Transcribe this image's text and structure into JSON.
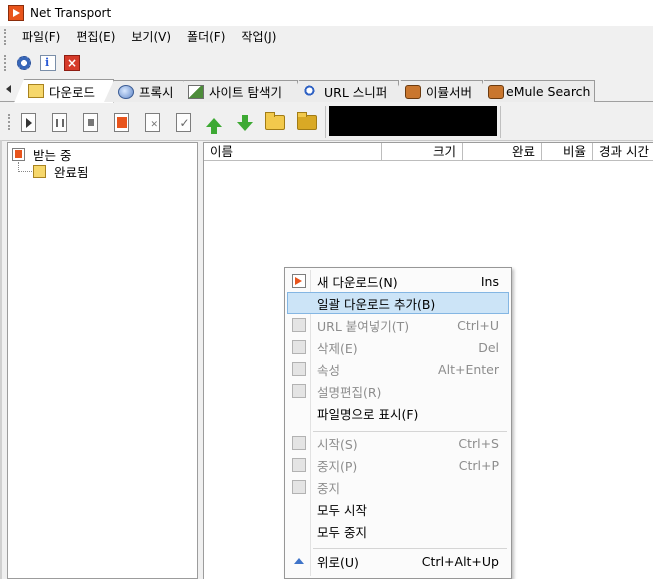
{
  "window": {
    "title": "Net Transport"
  },
  "menubar": [
    {
      "label": "파일(F)"
    },
    {
      "label": "편집(E)"
    },
    {
      "label": "보기(V)"
    },
    {
      "label": "폴더(F)"
    },
    {
      "label": "작업(J)"
    }
  ],
  "tabs": [
    {
      "label": "다운로드",
      "icon": "download-folder-icon"
    },
    {
      "label": "프록시",
      "icon": "proxy-globe-icon"
    },
    {
      "label": "사이트 탐색기",
      "icon": "site-explorer-icon"
    },
    {
      "label": "URL 스니퍼",
      "icon": "magnifier-icon"
    },
    {
      "label": "이뮬서버",
      "icon": "emule-icon"
    },
    {
      "label": "eMule Search",
      "icon": "emule-icon"
    }
  ],
  "tree": [
    {
      "label": "받는 중"
    },
    {
      "label": "완료됨"
    }
  ],
  "columns": [
    {
      "label": "이름"
    },
    {
      "label": "크기"
    },
    {
      "label": "완료"
    },
    {
      "label": "비율"
    },
    {
      "label": "경과 시간"
    }
  ],
  "context_menu": [
    {
      "label": "새 다운로드(N)",
      "shortcut": "Ins",
      "enabled": true
    },
    {
      "label": "일괄 다운로드 추가(B)",
      "shortcut": "",
      "enabled": true,
      "highlighted": true
    },
    {
      "label": "URL 붙여넣기(T)",
      "shortcut": "Ctrl+U",
      "enabled": false
    },
    {
      "label": "삭제(E)",
      "shortcut": "Del",
      "enabled": false
    },
    {
      "label": "속성",
      "shortcut": "Alt+Enter",
      "enabled": false
    },
    {
      "label": "설명편집(R)",
      "shortcut": "",
      "enabled": false
    },
    {
      "label": "파일명으로 표시(F)",
      "shortcut": "",
      "enabled": true
    },
    {
      "label": "시작(S)",
      "shortcut": "Ctrl+S",
      "enabled": false
    },
    {
      "label": "중지(P)",
      "shortcut": "Ctrl+P",
      "enabled": false
    },
    {
      "label": "중지",
      "shortcut": "",
      "enabled": false
    },
    {
      "label": "모두 시작",
      "shortcut": "",
      "enabled": true
    },
    {
      "label": "모두 중지",
      "shortcut": "",
      "enabled": true
    },
    {
      "label": "위로(U)",
      "shortcut": "Ctrl+Alt+Up",
      "enabled": true
    }
  ]
}
